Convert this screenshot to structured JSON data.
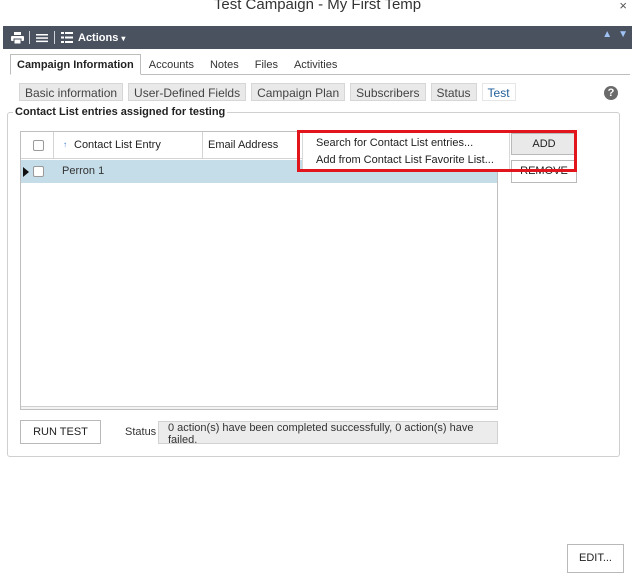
{
  "window": {
    "title": "Test Campaign - My First Temp",
    "close_glyph": "×"
  },
  "toolbar": {
    "print_icon": "print-icon",
    "list_icon": "list-icon",
    "actions_icon": "actions-icon",
    "actions_label": "Actions",
    "up_icon": "arrow-up-icon",
    "down_icon": "arrow-down-icon"
  },
  "main_tabs": [
    {
      "label": "Campaign Information",
      "active": true
    },
    {
      "label": "Accounts"
    },
    {
      "label": "Notes"
    },
    {
      "label": "Files"
    },
    {
      "label": "Activities"
    }
  ],
  "sub_tabs": [
    {
      "label": "Basic information"
    },
    {
      "label": "User-Defined Fields"
    },
    {
      "label": "Campaign Plan"
    },
    {
      "label": "Subscribers"
    },
    {
      "label": "Status"
    },
    {
      "label": "Test",
      "active": true
    }
  ],
  "help_glyph": "?",
  "section": {
    "legend": "Contact List entries assigned for testing",
    "columns": {
      "entry": "Contact List Entry",
      "email": "Email Address",
      "sort_glyph": "↑"
    },
    "rows": [
      {
        "entry": "Perron 1",
        "email": ""
      }
    ]
  },
  "buttons": {
    "add": "ADD",
    "remove": "REMOVE",
    "run_test": "RUN TEST",
    "edit": "EDIT..."
  },
  "add_menu": [
    "Search for Contact List entries...",
    "Add from Contact List Favorite List..."
  ],
  "status": {
    "label": "Status",
    "text": "0 action(s) have been completed successfully, 0 action(s) have failed."
  },
  "colors": {
    "toolbar": "#4a5260",
    "selected_row": "#c5dde8",
    "highlight": "#e2141c",
    "active_tab_text": "#1f5e99"
  }
}
